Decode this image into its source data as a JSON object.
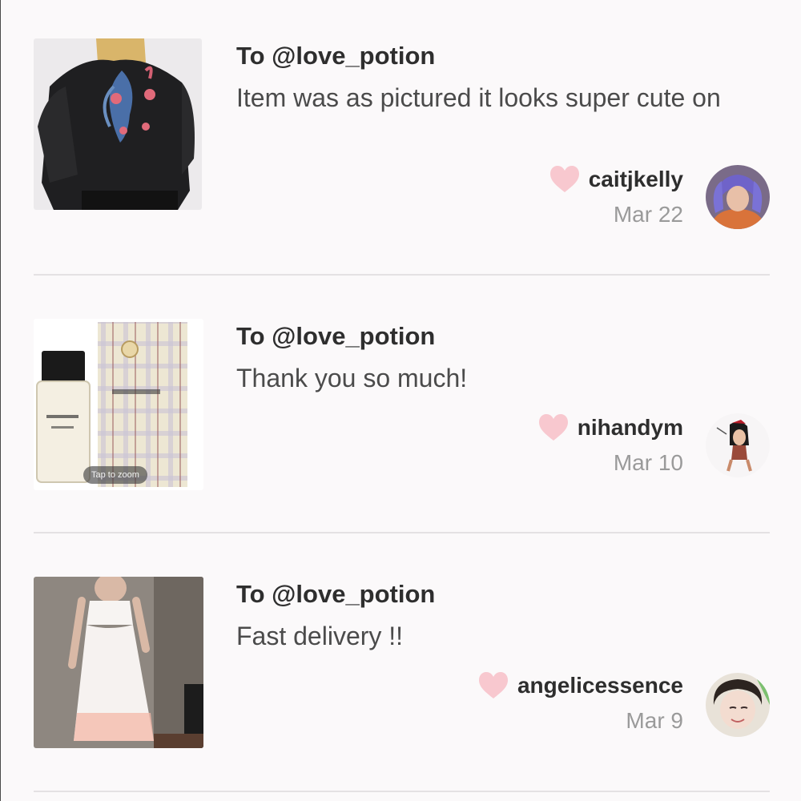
{
  "reviews": [
    {
      "to": "To @love_potion",
      "message": "Item was as pictured it looks super cute on",
      "username": "caitjkelly",
      "date": "Mar 22",
      "item_image": "leather-jacket-photo",
      "avatar_image": "purple-haired-woman-photo"
    },
    {
      "to": "To @love_potion",
      "message": "Thank you so much!",
      "username": "nihandym",
      "date": "Mar 10",
      "item_image": "burberry-perfume-photo",
      "zoom_hint": "Tap to zoom",
      "avatar_image": "bitmoji-avatar"
    },
    {
      "to": "To @love_potion",
      "message": "Fast delivery !!",
      "username": "angelicessence",
      "date": "Mar 9",
      "item_image": "white-dress-photo",
      "avatar_image": "smiling-woman-photo"
    }
  ],
  "icons": {
    "like": "heart-icon"
  },
  "colors": {
    "heart": "#f8c8cf",
    "background": "#fbf9fa",
    "divider": "#e4e1e3",
    "date_text": "#9a9a9a"
  }
}
